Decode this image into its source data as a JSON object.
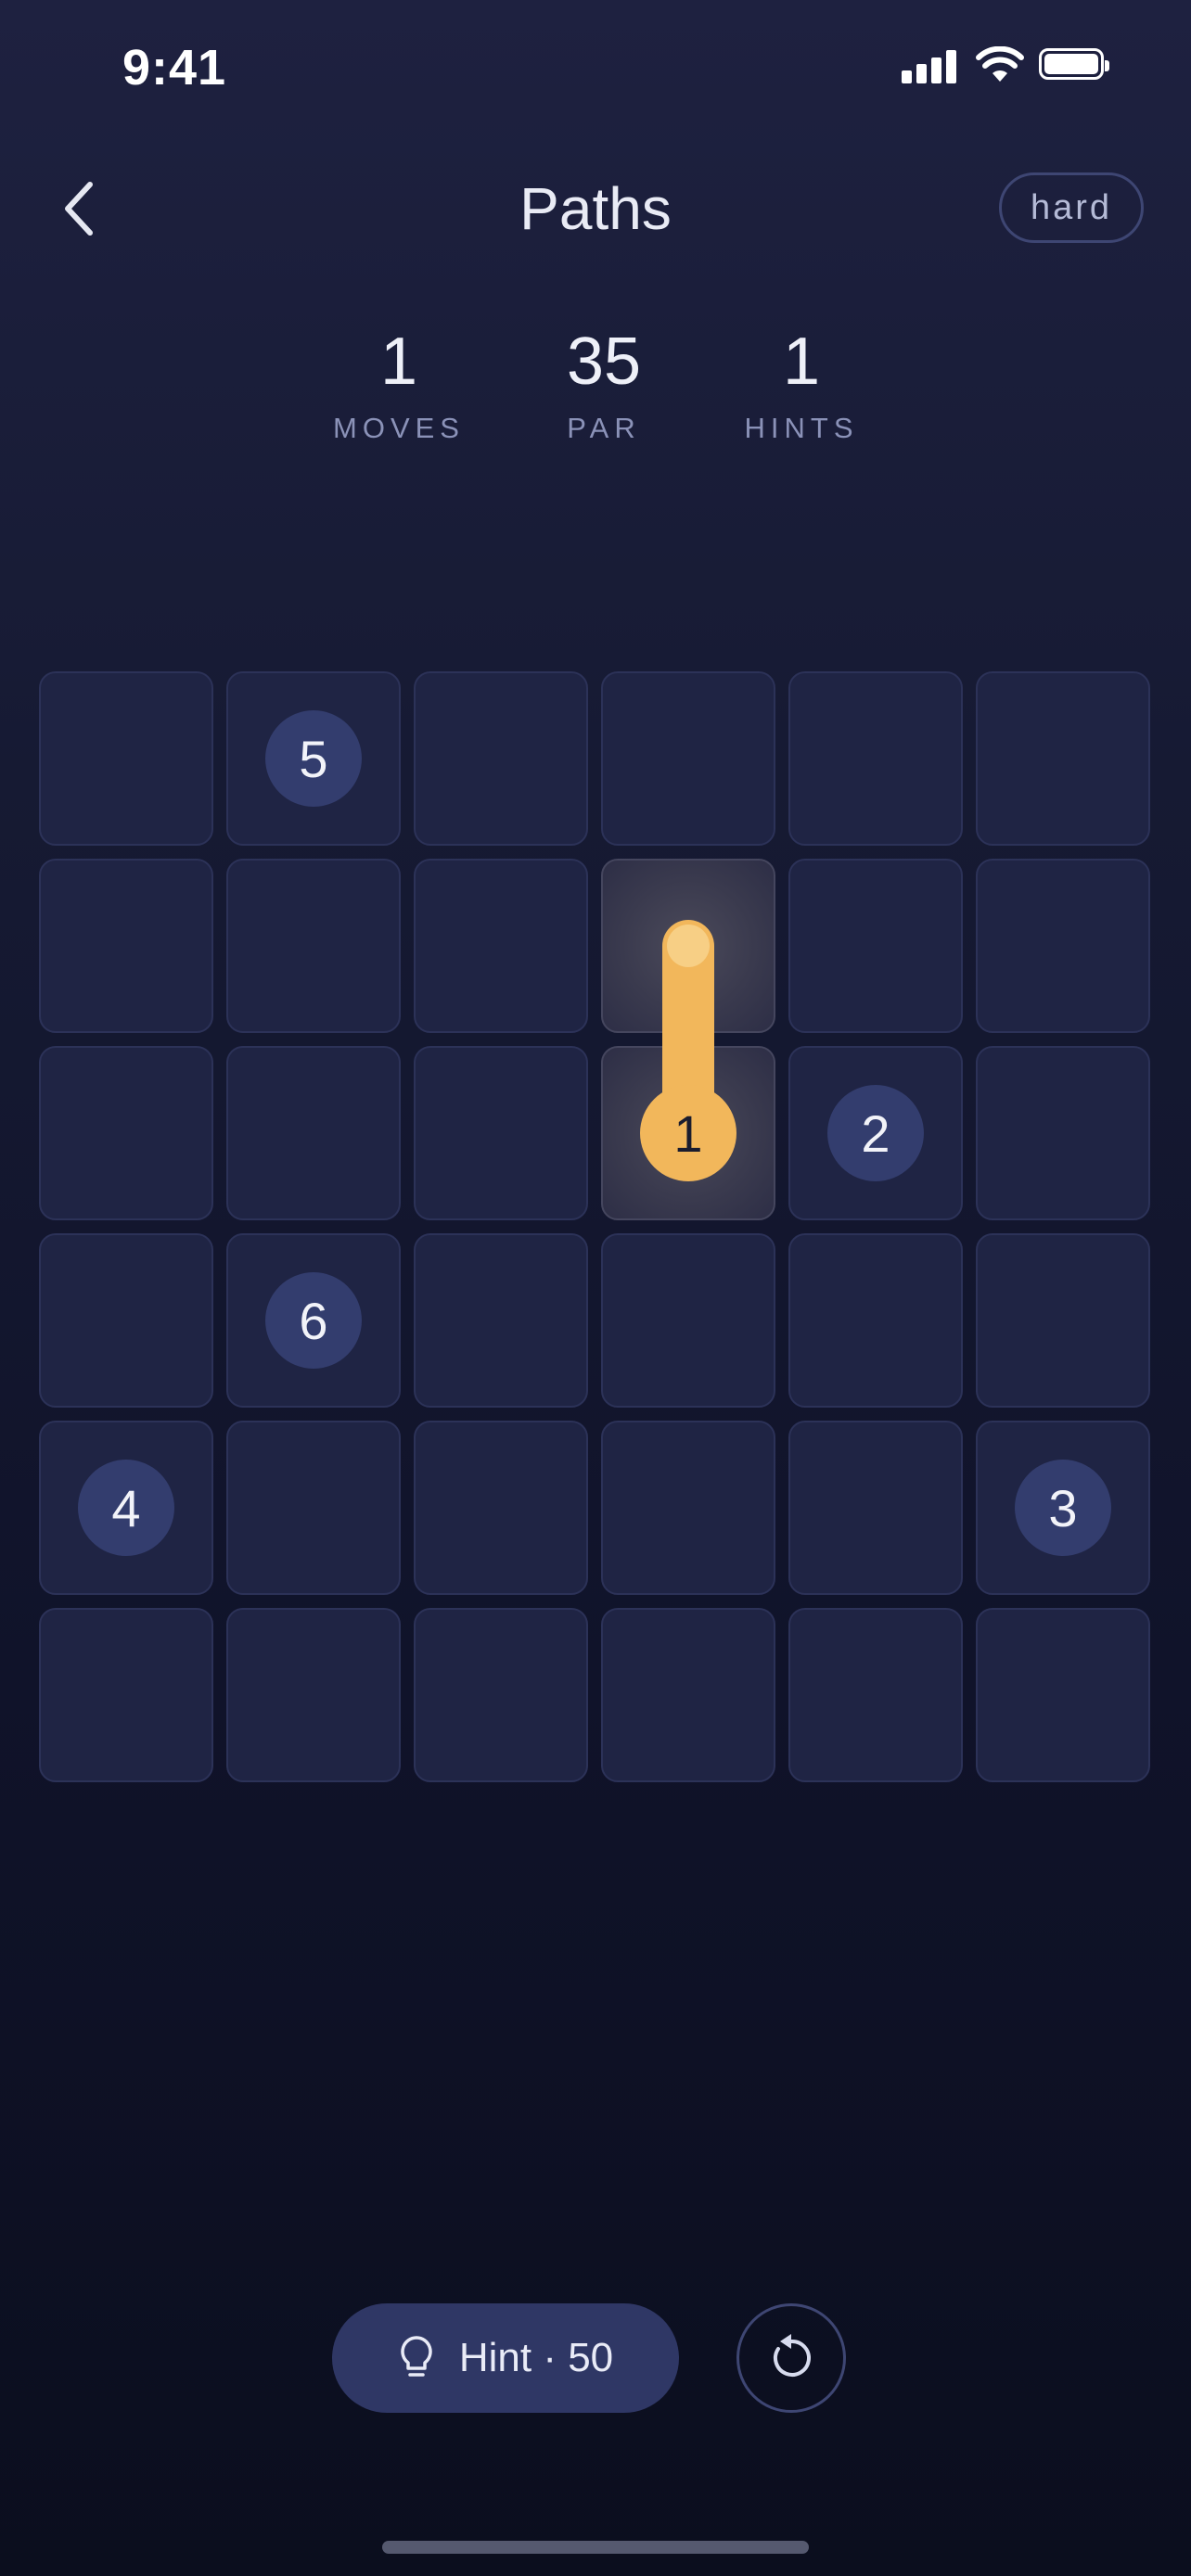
{
  "status": {
    "time": "9:41"
  },
  "header": {
    "title": "Paths",
    "difficulty": "hard"
  },
  "stats": [
    {
      "value": "1",
      "label": "MOVES"
    },
    {
      "value": "35",
      "label": "PAR"
    },
    {
      "value": "1",
      "label": "HINTS"
    }
  ],
  "board": {
    "rows": 6,
    "cols": 6,
    "nodes": [
      {
        "label": "5",
        "row": 0,
        "col": 1,
        "active": false
      },
      {
        "label": "1",
        "row": 2,
        "col": 3,
        "active": true
      },
      {
        "label": "2",
        "row": 2,
        "col": 4,
        "active": false
      },
      {
        "label": "6",
        "row": 3,
        "col": 1,
        "active": false
      },
      {
        "label": "4",
        "row": 4,
        "col": 0,
        "active": false
      },
      {
        "label": "3",
        "row": 4,
        "col": 5,
        "active": false
      }
    ],
    "path": [
      {
        "row": 2,
        "col": 3
      },
      {
        "row": 1,
        "col": 3
      }
    ]
  },
  "controls": {
    "hint_label": "Hint · 50"
  },
  "colors": {
    "accent": "#f2b75b",
    "node": "#333d6e",
    "cell": "#1f2444"
  }
}
